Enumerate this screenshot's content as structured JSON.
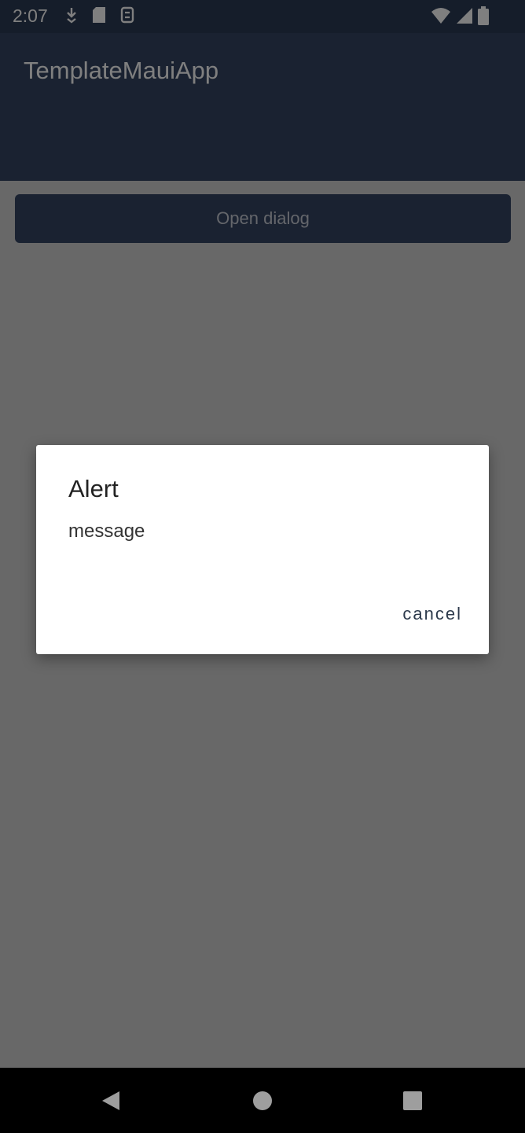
{
  "status_bar": {
    "time": "2:07",
    "left_icons": [
      "download-icon",
      "sd-card-icon",
      "sync-icon"
    ],
    "right_icons": [
      "wifi-icon",
      "signal-icon",
      "battery-icon"
    ]
  },
  "app_bar": {
    "title": "TemplateMauiApp"
  },
  "main": {
    "open_dialog_label": "Open dialog"
  },
  "dialog": {
    "title": "Alert",
    "message": "message",
    "cancel_label": "cancel"
  },
  "nav_bar": {
    "buttons": [
      "back-icon",
      "home-icon",
      "recents-icon"
    ]
  },
  "colors": {
    "primary": "#344563",
    "status_bar": "#2b3a55",
    "dialog_bg": "#ffffff",
    "cancel_text": "#2d3a4c"
  }
}
